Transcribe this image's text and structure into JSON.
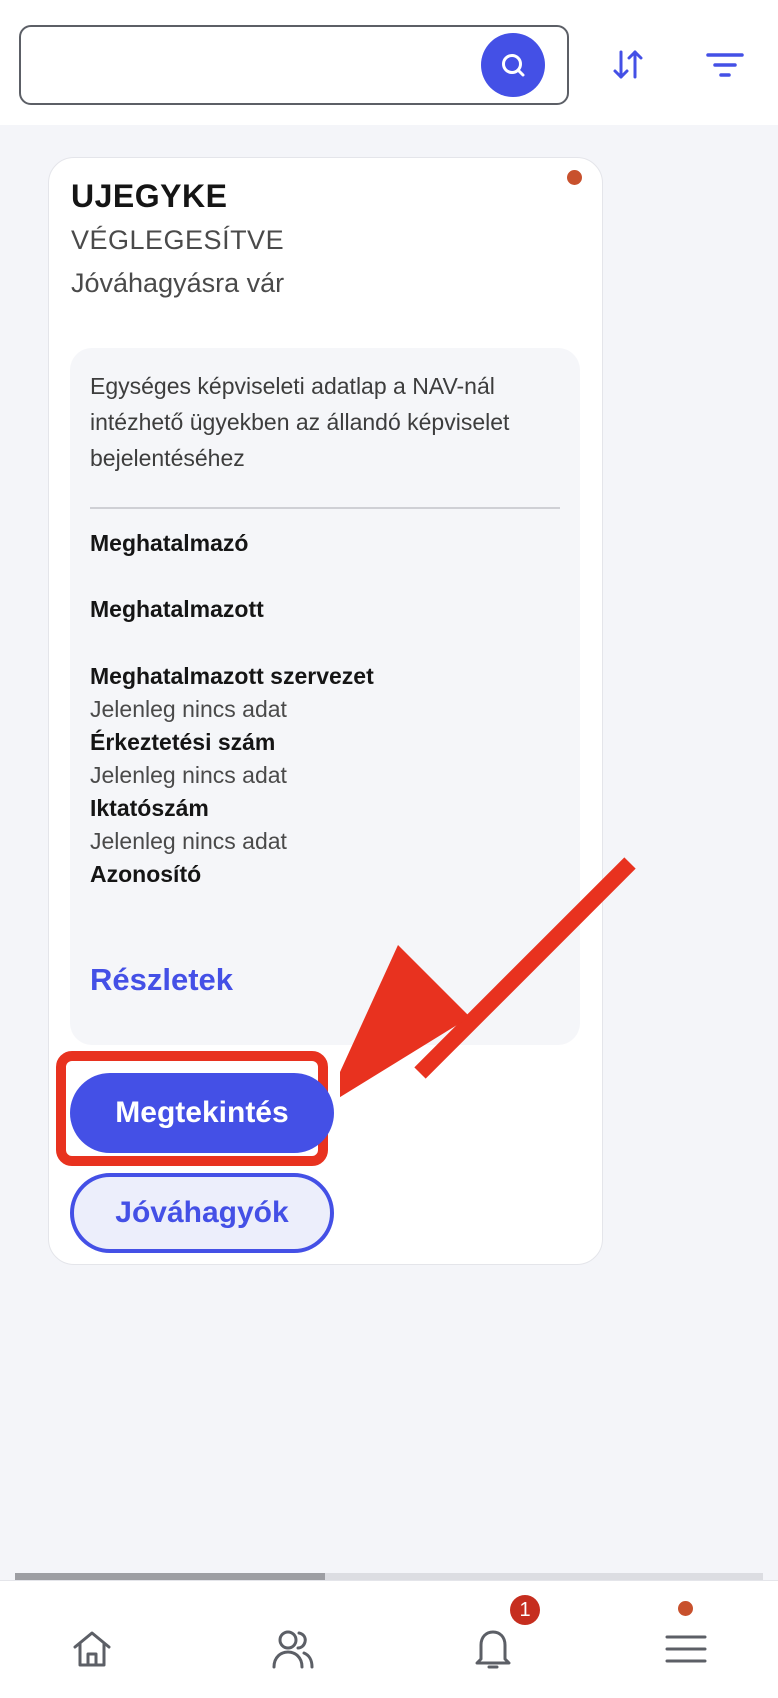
{
  "search": {
    "placeholder": "",
    "value": ""
  },
  "icons": {
    "search": "search-icon",
    "sort": "sort-arrows-icon",
    "filter": "filter-icon",
    "home": "home-icon",
    "people": "people-icon",
    "bell": "bell-icon",
    "menu": "hamburger-menu-icon"
  },
  "colors": {
    "accent": "#4450e6",
    "status_dot": "#c8512d",
    "highlight": "#e8321f",
    "badge": "#c62e1f"
  },
  "card": {
    "title": "UJEGYKE",
    "status": "VÉGLEGESÍTVE",
    "substatus": "Jóváhagyásra vár",
    "description": "Egységes képviseleti adatlap a NAV-nál intézhető ügyekben az állandó képviselet bejelentéséhez",
    "fields": [
      {
        "label": "Meghatalmazó",
        "value": ""
      },
      {
        "label": "Meghatalmazott",
        "value": ""
      },
      {
        "label": "Meghatalmazott szervezet",
        "value": "Jelenleg nincs adat"
      },
      {
        "label": "Érkeztetési szám",
        "value": "Jelenleg nincs adat"
      },
      {
        "label": "Iktatószám",
        "value": "Jelenleg nincs adat"
      },
      {
        "label": "Azonosító",
        "value": ""
      }
    ],
    "details_link": "Részletek",
    "primary_button": "Megtekintés",
    "secondary_button": "Jóváhagyók"
  },
  "nav": {
    "notifications_count": "1"
  }
}
